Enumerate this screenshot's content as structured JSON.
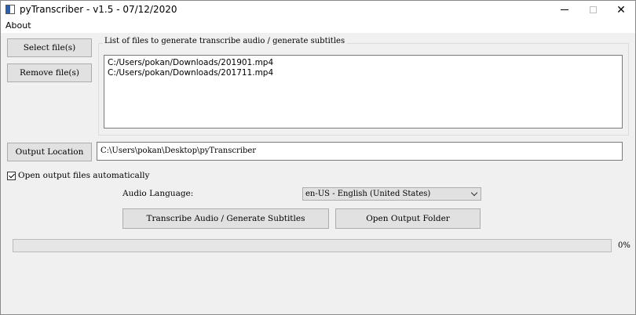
{
  "window": {
    "title": "pyTranscriber - v1.5 - 07/12/2020",
    "minimize_icon": "minimize-icon",
    "maximize_icon": "maximize-icon",
    "close_glyph": "✕"
  },
  "menu": {
    "about_label": "About"
  },
  "buttons": {
    "select_files": "Select file(s)",
    "remove_files": "Remove file(s)",
    "output_location": "Output Location",
    "transcribe": "Transcribe Audio / Generate Subtitles",
    "open_output_folder": "Open Output Folder"
  },
  "file_list": {
    "group_title": "List of files to generate transcribe audio / generate subtitles",
    "items": [
      "C:/Users/pokan/Downloads/201901.mp4",
      "C:/Users/pokan/Downloads/201711.mp4"
    ]
  },
  "output_location": {
    "value": "C:\\Users\\pokan\\Desktop\\pyTranscriber"
  },
  "options": {
    "open_automatically_label": "Open output files automatically",
    "open_automatically_checked": true
  },
  "language": {
    "label": "Audio Language:",
    "selected": "en-US - English (United States)"
  },
  "progress": {
    "value": 0,
    "text": "0%",
    "fill_color": "#06b025"
  }
}
